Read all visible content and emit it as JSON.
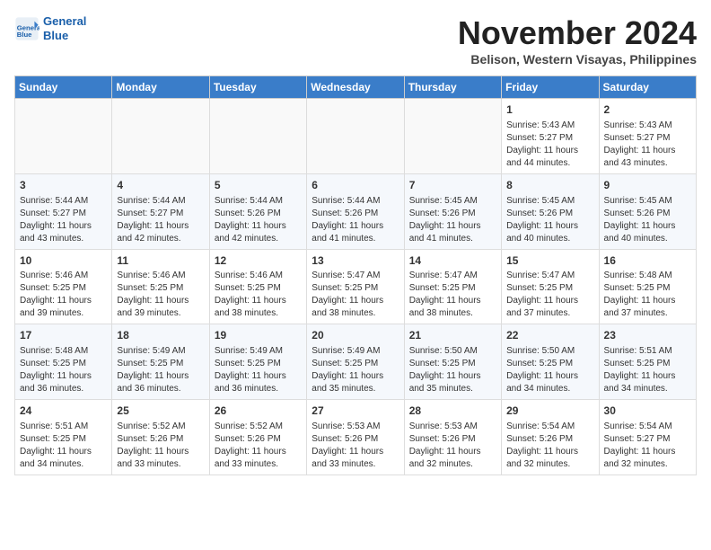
{
  "header": {
    "logo_line1": "General",
    "logo_line2": "Blue",
    "month": "November 2024",
    "location": "Belison, Western Visayas, Philippines"
  },
  "weekdays": [
    "Sunday",
    "Monday",
    "Tuesday",
    "Wednesday",
    "Thursday",
    "Friday",
    "Saturday"
  ],
  "weeks": [
    [
      {
        "day": "",
        "info": ""
      },
      {
        "day": "",
        "info": ""
      },
      {
        "day": "",
        "info": ""
      },
      {
        "day": "",
        "info": ""
      },
      {
        "day": "",
        "info": ""
      },
      {
        "day": "1",
        "info": "Sunrise: 5:43 AM\nSunset: 5:27 PM\nDaylight: 11 hours\nand 44 minutes."
      },
      {
        "day": "2",
        "info": "Sunrise: 5:43 AM\nSunset: 5:27 PM\nDaylight: 11 hours\nand 43 minutes."
      }
    ],
    [
      {
        "day": "3",
        "info": "Sunrise: 5:44 AM\nSunset: 5:27 PM\nDaylight: 11 hours\nand 43 minutes."
      },
      {
        "day": "4",
        "info": "Sunrise: 5:44 AM\nSunset: 5:27 PM\nDaylight: 11 hours\nand 42 minutes."
      },
      {
        "day": "5",
        "info": "Sunrise: 5:44 AM\nSunset: 5:26 PM\nDaylight: 11 hours\nand 42 minutes."
      },
      {
        "day": "6",
        "info": "Sunrise: 5:44 AM\nSunset: 5:26 PM\nDaylight: 11 hours\nand 41 minutes."
      },
      {
        "day": "7",
        "info": "Sunrise: 5:45 AM\nSunset: 5:26 PM\nDaylight: 11 hours\nand 41 minutes."
      },
      {
        "day": "8",
        "info": "Sunrise: 5:45 AM\nSunset: 5:26 PM\nDaylight: 11 hours\nand 40 minutes."
      },
      {
        "day": "9",
        "info": "Sunrise: 5:45 AM\nSunset: 5:26 PM\nDaylight: 11 hours\nand 40 minutes."
      }
    ],
    [
      {
        "day": "10",
        "info": "Sunrise: 5:46 AM\nSunset: 5:25 PM\nDaylight: 11 hours\nand 39 minutes."
      },
      {
        "day": "11",
        "info": "Sunrise: 5:46 AM\nSunset: 5:25 PM\nDaylight: 11 hours\nand 39 minutes."
      },
      {
        "day": "12",
        "info": "Sunrise: 5:46 AM\nSunset: 5:25 PM\nDaylight: 11 hours\nand 38 minutes."
      },
      {
        "day": "13",
        "info": "Sunrise: 5:47 AM\nSunset: 5:25 PM\nDaylight: 11 hours\nand 38 minutes."
      },
      {
        "day": "14",
        "info": "Sunrise: 5:47 AM\nSunset: 5:25 PM\nDaylight: 11 hours\nand 38 minutes."
      },
      {
        "day": "15",
        "info": "Sunrise: 5:47 AM\nSunset: 5:25 PM\nDaylight: 11 hours\nand 37 minutes."
      },
      {
        "day": "16",
        "info": "Sunrise: 5:48 AM\nSunset: 5:25 PM\nDaylight: 11 hours\nand 37 minutes."
      }
    ],
    [
      {
        "day": "17",
        "info": "Sunrise: 5:48 AM\nSunset: 5:25 PM\nDaylight: 11 hours\nand 36 minutes."
      },
      {
        "day": "18",
        "info": "Sunrise: 5:49 AM\nSunset: 5:25 PM\nDaylight: 11 hours\nand 36 minutes."
      },
      {
        "day": "19",
        "info": "Sunrise: 5:49 AM\nSunset: 5:25 PM\nDaylight: 11 hours\nand 36 minutes."
      },
      {
        "day": "20",
        "info": "Sunrise: 5:49 AM\nSunset: 5:25 PM\nDaylight: 11 hours\nand 35 minutes."
      },
      {
        "day": "21",
        "info": "Sunrise: 5:50 AM\nSunset: 5:25 PM\nDaylight: 11 hours\nand 35 minutes."
      },
      {
        "day": "22",
        "info": "Sunrise: 5:50 AM\nSunset: 5:25 PM\nDaylight: 11 hours\nand 34 minutes."
      },
      {
        "day": "23",
        "info": "Sunrise: 5:51 AM\nSunset: 5:25 PM\nDaylight: 11 hours\nand 34 minutes."
      }
    ],
    [
      {
        "day": "24",
        "info": "Sunrise: 5:51 AM\nSunset: 5:25 PM\nDaylight: 11 hours\nand 34 minutes."
      },
      {
        "day": "25",
        "info": "Sunrise: 5:52 AM\nSunset: 5:26 PM\nDaylight: 11 hours\nand 33 minutes."
      },
      {
        "day": "26",
        "info": "Sunrise: 5:52 AM\nSunset: 5:26 PM\nDaylight: 11 hours\nand 33 minutes."
      },
      {
        "day": "27",
        "info": "Sunrise: 5:53 AM\nSunset: 5:26 PM\nDaylight: 11 hours\nand 33 minutes."
      },
      {
        "day": "28",
        "info": "Sunrise: 5:53 AM\nSunset: 5:26 PM\nDaylight: 11 hours\nand 32 minutes."
      },
      {
        "day": "29",
        "info": "Sunrise: 5:54 AM\nSunset: 5:26 PM\nDaylight: 11 hours\nand 32 minutes."
      },
      {
        "day": "30",
        "info": "Sunrise: 5:54 AM\nSunset: 5:27 PM\nDaylight: 11 hours\nand 32 minutes."
      }
    ]
  ]
}
